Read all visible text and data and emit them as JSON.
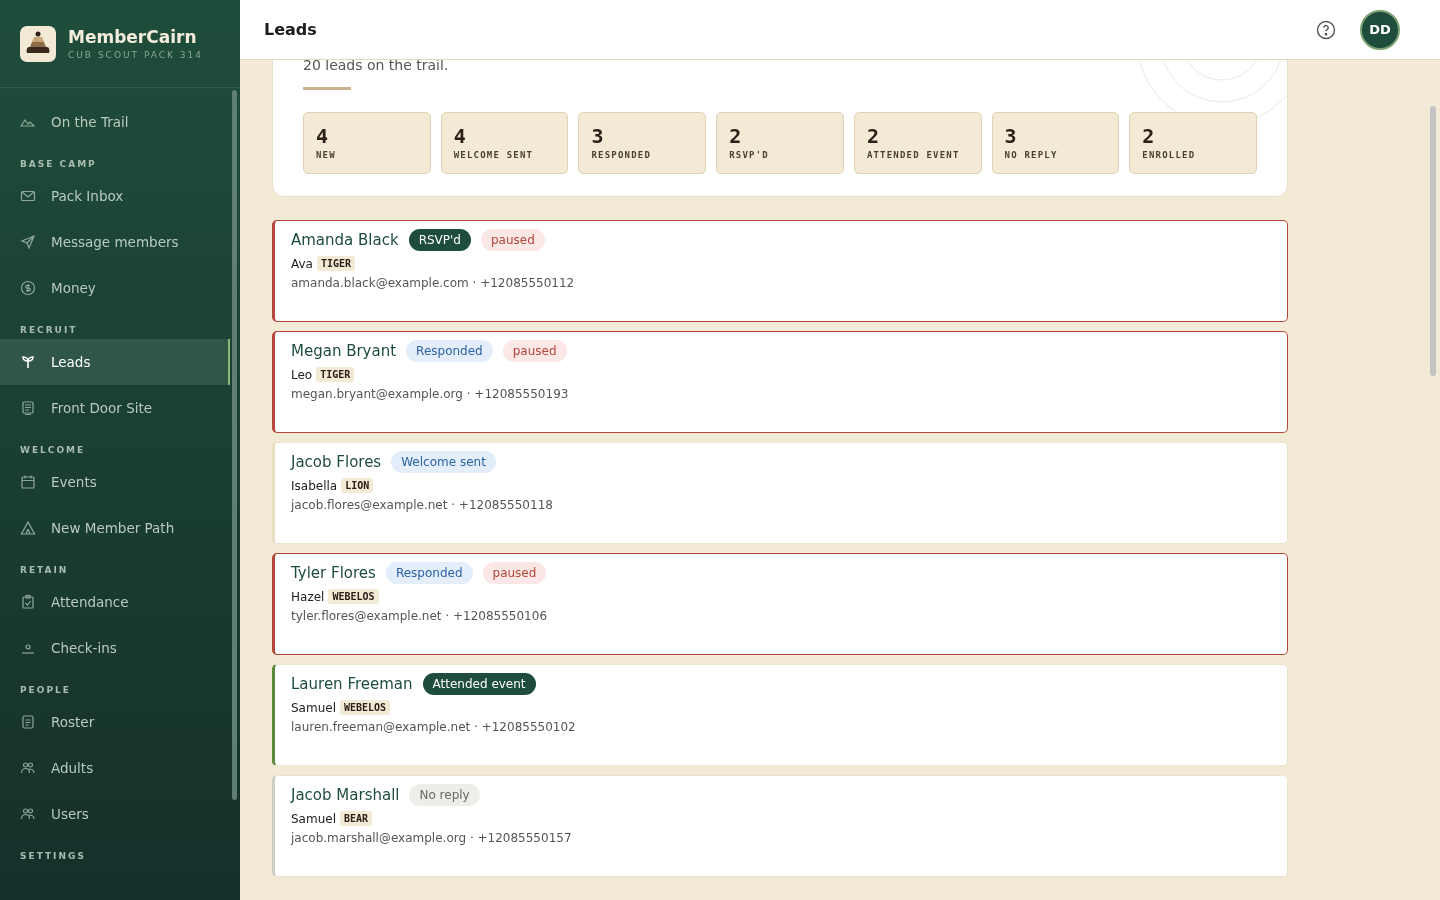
{
  "brand": {
    "name": "MemberCairn",
    "subtitle": "CUB SCOUT PACK 314"
  },
  "sidebar": {
    "sections": [
      {
        "items": [
          {
            "label": "On the Trail",
            "kind": "mountain",
            "selected": false
          }
        ]
      },
      {
        "heading": "BASE CAMP",
        "items": [
          {
            "label": "Pack Inbox",
            "kind": "mail",
            "selected": false
          },
          {
            "label": "Message members",
            "kind": "send",
            "selected": false
          },
          {
            "label": "Money",
            "kind": "dollar",
            "selected": false
          }
        ]
      },
      {
        "heading": "RECRUIT",
        "items": [
          {
            "label": "Leads",
            "kind": "sprout",
            "selected": true
          },
          {
            "label": "Front Door Site",
            "kind": "page",
            "selected": false
          }
        ]
      },
      {
        "heading": "WELCOME",
        "items": [
          {
            "label": "Events",
            "kind": "calendar",
            "selected": false
          },
          {
            "label": "New Member Path",
            "kind": "tent",
            "selected": false
          }
        ]
      },
      {
        "heading": "RETAIN",
        "items": [
          {
            "label": "Attendance",
            "kind": "clipboard",
            "selected": false
          },
          {
            "label": "Check-ins",
            "kind": "pin",
            "selected": false
          }
        ]
      },
      {
        "heading": "PEOPLE",
        "items": [
          {
            "label": "Roster",
            "kind": "list",
            "selected": false
          },
          {
            "label": "Adults",
            "kind": "people",
            "selected": false
          },
          {
            "label": "Users",
            "kind": "people",
            "selected": false
          }
        ]
      },
      {
        "heading": "SETTINGS"
      }
    ]
  },
  "header": {
    "title": "Leads",
    "avatar": "DD"
  },
  "summary": {
    "text": "20 leads on the trail.",
    "stats": [
      {
        "count": "4",
        "label": "NEW"
      },
      {
        "count": "4",
        "label": "WELCOME SENT"
      },
      {
        "count": "3",
        "label": "RESPONDED"
      },
      {
        "count": "2",
        "label": "RSVP'D"
      },
      {
        "count": "2",
        "label": "ATTENDED EVENT"
      },
      {
        "count": "3",
        "label": "NO REPLY"
      },
      {
        "count": "2",
        "label": "ENROLLED"
      }
    ]
  },
  "leads": [
    {
      "name": "Amanda Black",
      "stage": {
        "label": "RSVP'd",
        "kind": "dark"
      },
      "paused": true,
      "paused_label": "paused",
      "child": "Ava",
      "rank": "TIGER",
      "contact": "amanda.black@example.com · +12085550112"
    },
    {
      "name": "Megan Bryant",
      "stage": {
        "label": "Responded",
        "kind": "blue"
      },
      "paused": true,
      "paused_label": "paused",
      "child": "Leo",
      "rank": "TIGER",
      "contact": "megan.bryant@example.org · +12085550193"
    },
    {
      "name": "Jacob Flores",
      "stage": {
        "label": "Welcome sent",
        "kind": "blue"
      },
      "paused": false,
      "child": "Isabella",
      "rank": "LION",
      "contact": "jacob.flores@example.net · +12085550118"
    },
    {
      "name": "Tyler Flores",
      "stage": {
        "label": "Responded",
        "kind": "blue"
      },
      "paused": true,
      "paused_label": "paused",
      "child": "Hazel",
      "rank": "WEBELOS",
      "contact": "tyler.flores@example.net · +12085550106"
    },
    {
      "name": "Lauren Freeman",
      "stage": {
        "label": "Attended event",
        "kind": "dark"
      },
      "paused": false,
      "child": "Samuel",
      "rank": "WEBELOS",
      "contact": "lauren.freeman@example.net · +12085550102"
    },
    {
      "name": "Jacob Marshall",
      "stage": {
        "label": "No reply",
        "kind": "grey"
      },
      "paused": false,
      "child": "Samuel",
      "rank": "BEAR",
      "contact": "jacob.marshall@example.org · +12085550157"
    }
  ]
}
